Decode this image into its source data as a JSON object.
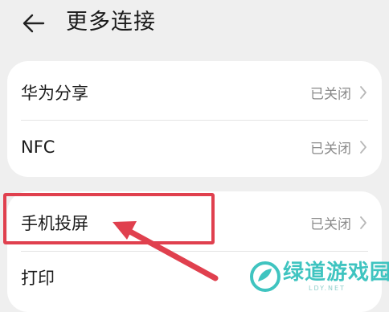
{
  "header": {
    "title": "更多连接",
    "back_icon": "arrow-left-icon"
  },
  "groups": [
    {
      "items": [
        {
          "label": "华为分享",
          "status": "已关闭"
        },
        {
          "label": "NFC",
          "status": "已关闭"
        }
      ]
    },
    {
      "items": [
        {
          "label": "手机投屏",
          "status": "已关闭",
          "highlighted": true
        },
        {
          "label": "打印",
          "status": ""
        }
      ]
    }
  ],
  "annotation": {
    "highlight_color": "#e0404e",
    "arrow_color": "#e0404e"
  },
  "watermark": {
    "text": "绿道游戏园",
    "subtext": "LDY.NET",
    "color": "#3fc4c0"
  }
}
